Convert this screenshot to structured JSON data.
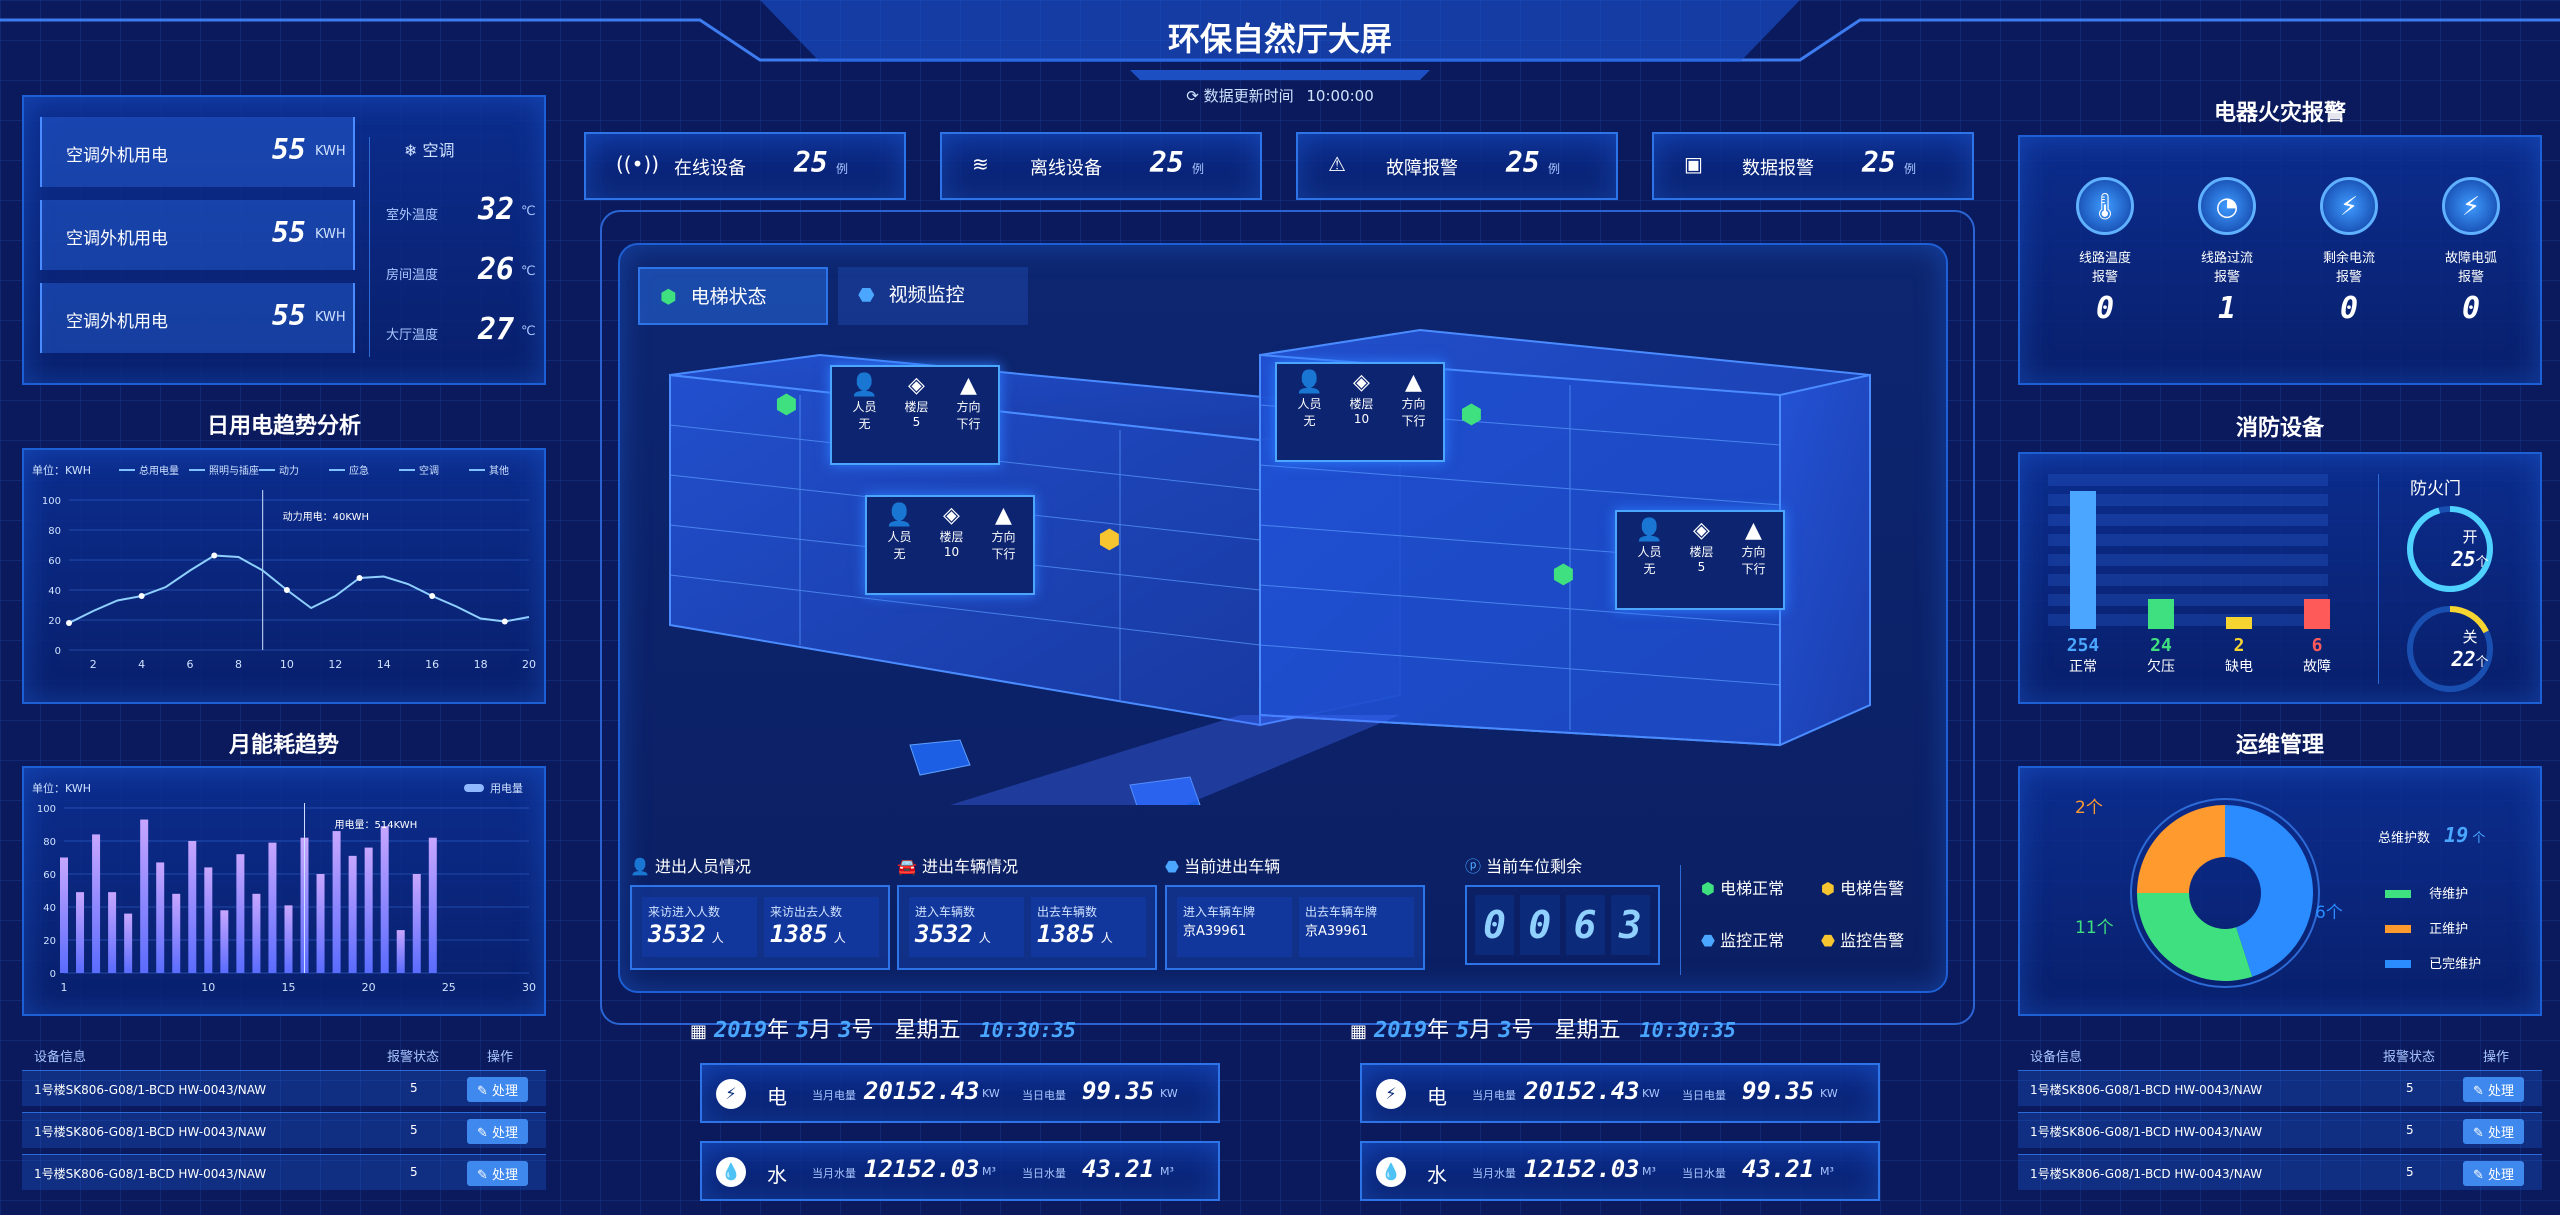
{
  "header": {
    "title": "环保自然厅大屏",
    "update_label": "数据更新时间",
    "update_time": "10:00:00"
  },
  "ac": {
    "rows": [
      {
        "label": "空调外机用电",
        "value": "55",
        "unit": "KWH"
      },
      {
        "label": "空调外机用电",
        "value": "55",
        "unit": "KWH"
      },
      {
        "label": "空调外机用电",
        "value": "55",
        "unit": "KWH"
      }
    ],
    "right_title": "空调",
    "temps": [
      {
        "label": "室外温度",
        "value": "32",
        "unit": "℃"
      },
      {
        "label": "房间温度",
        "value": "26",
        "unit": "℃"
      },
      {
        "label": "大厅温度",
        "value": "27",
        "unit": "℃"
      }
    ]
  },
  "daily": {
    "title": "日用电趋势分析",
    "unit": "单位：KWH",
    "legend": [
      "总用电量",
      "照明与插座",
      "动力",
      "应急",
      "空调",
      "其他"
    ],
    "tooltip": "动力用电：40KWH"
  },
  "monthly": {
    "title": "月能耗趋势",
    "unit": "单位：KWH",
    "legend": "用电量",
    "tooltip": "用电量：514KWH"
  },
  "stats": [
    {
      "label": "在线设备",
      "value": "25",
      "unit": "例"
    },
    {
      "label": "离线设备",
      "value": "25",
      "unit": "例"
    },
    {
      "label": "故障报警",
      "value": "25",
      "unit": "例"
    },
    {
      "label": "数据报警",
      "value": "25",
      "unit": "例"
    }
  ],
  "tabs": [
    "电梯状态",
    "视频监控"
  ],
  "elevators": [
    {
      "person_label": "人员",
      "person": "无",
      "floor_label": "楼层",
      "floor": "5",
      "dir_label": "方向",
      "dir": "下行"
    },
    {
      "person_label": "人员",
      "person": "无",
      "floor_label": "楼层",
      "floor": "10",
      "dir_label": "方向",
      "dir": "下行"
    },
    {
      "person_label": "人员",
      "person": "无",
      "floor_label": "楼层",
      "floor": "10",
      "dir_label": "方向",
      "dir": "下行"
    },
    {
      "person_label": "人员",
      "person": "无",
      "floor_label": "楼层",
      "floor": "5",
      "dir_label": "方向",
      "dir": "下行"
    }
  ],
  "people": {
    "title": "进出人员情况",
    "in_label": "来访进入人数",
    "in": "3532",
    "out_label": "来访出去人数",
    "out": "1385",
    "unit": "人"
  },
  "vehicles": {
    "title": "进出车辆情况",
    "in_label": "进入车辆数",
    "in": "3532",
    "out_label": "出去车辆数",
    "out": "1385",
    "unit": "人"
  },
  "current_vehicle": {
    "title": "当前进出车辆",
    "in_label": "进入车辆车牌",
    "in": "京A39961",
    "out_label": "出去车辆车牌",
    "out": "京A39961"
  },
  "parking": {
    "title": "当前车位剩余",
    "digits": [
      "0",
      "0",
      "6",
      "3"
    ]
  },
  "legend_status": [
    "电梯正常",
    "电梯告警",
    "监控正常",
    "监控告警"
  ],
  "dates": [
    {
      "year": "2019",
      "y": "年",
      "month": "5",
      "m": "月",
      "day": "3",
      "d": "号",
      "week": "星期五",
      "time": "10:30:35"
    },
    {
      "year": "2019",
      "y": "年",
      "month": "5",
      "m": "月",
      "day": "3",
      "d": "号",
      "week": "星期五",
      "time": "10:30:35"
    }
  ],
  "meters": [
    {
      "elec_label": "电",
      "water_label": "水",
      "cur_label": "当月电量",
      "cur": "20152.43",
      "cur_unit": "KW",
      "day_label": "当日电量",
      "day": "99.35",
      "day_unit": "KW",
      "wcur_label": "当月水量",
      "wcur": "12152.03",
      "wunit": "M³",
      "wday_label": "当日水量",
      "wday": "43.21"
    },
    {
      "elec_label": "电",
      "water_label": "水",
      "cur_label": "当月电量",
      "cur": "20152.43",
      "cur_unit": "KW",
      "day_label": "当日电量",
      "day": "99.35",
      "day_unit": "KW",
      "wcur_label": "当月水量",
      "wcur": "12152.03",
      "wunit": "M³",
      "wday_label": "当日水量",
      "wday": "43.21"
    }
  ],
  "table": {
    "headers": [
      "设备信息",
      "报警状态",
      "操作"
    ],
    "rows": [
      {
        "info": "1号楼SK806-G08/1-BCD HW-0043/NAW",
        "status": "5",
        "op": "处理"
      },
      {
        "info": "1号楼SK806-G08/1-BCD HW-0043/NAW",
        "status": "5",
        "op": "处理"
      },
      {
        "info": "1号楼SK806-G08/1-BCD HW-0043/NAW",
        "status": "5",
        "op": "处理"
      }
    ]
  },
  "fire": {
    "title": "电器火灾报警",
    "items": [
      {
        "label1": "线路温度",
        "label2": "报警",
        "value": "0"
      },
      {
        "label1": "线路过流",
        "label2": "报警",
        "value": "1"
      },
      {
        "label1": "剩余电流",
        "label2": "报警",
        "value": "0"
      },
      {
        "label1": "故障电弧",
        "label2": "报警",
        "value": "0"
      }
    ]
  },
  "fireprot": {
    "title": "消防设备",
    "bars": [
      {
        "value": "254",
        "label": "正常",
        "color": "#4aa6ff",
        "h": 0.92
      },
      {
        "value": "24",
        "label": "欠压",
        "color": "#3fe07f",
        "h": 0.2
      },
      {
        "value": "2",
        "label": "缺电",
        "color": "#f6d531",
        "h": 0.08
      },
      {
        "value": "6",
        "label": "故障",
        "color": "#ff5a5a",
        "h": 0.2
      }
    ],
    "door_title": "防火门",
    "open_label": "开",
    "open": "25",
    "close_label": "关",
    "close": "22",
    "count_unit": "个"
  },
  "ops": {
    "title": "运维管理",
    "total_label": "总维护数",
    "total": "19",
    "total_unit": "个",
    "slices": [
      {
        "label": "待维护",
        "value": "11个",
        "color": "#3fe07f",
        "frac": 0.3
      },
      {
        "label": "正维护",
        "value": "2个",
        "color": "#ff9a2e",
        "frac": 0.25
      },
      {
        "label": "已完维护",
        "value": "6个",
        "color": "#2a8cff",
        "frac": 0.45
      }
    ]
  },
  "chart_data": [
    {
      "type": "line",
      "title": "日用电趋势分析",
      "x": [
        1,
        2,
        3,
        4,
        5,
        6,
        7,
        8,
        9,
        10,
        11,
        12,
        13,
        14,
        15,
        16,
        17,
        18,
        19,
        20
      ],
      "y": [
        18,
        26,
        33,
        36,
        42,
        53,
        63,
        62,
        53,
        40,
        28,
        36,
        48,
        49,
        44,
        36,
        29,
        21,
        19,
        22
      ],
      "ylim": [
        0,
        100
      ],
      "xticks": [
        2,
        4,
        6,
        8,
        10,
        12,
        14,
        16,
        18,
        20
      ],
      "yticks": [
        0,
        20,
        40,
        60,
        80,
        100
      ]
    },
    {
      "type": "bar",
      "title": "月能耗趋势",
      "x": [
        1,
        2,
        3,
        4,
        5,
        6,
        7,
        8,
        9,
        10,
        11,
        12,
        13,
        14,
        15,
        16,
        17,
        18,
        19,
        20,
        21,
        22,
        23,
        24,
        25,
        26,
        27,
        28,
        29,
        30
      ],
      "values": [
        70,
        49,
        84,
        49,
        36,
        93,
        67,
        48,
        80,
        64,
        38,
        72,
        48,
        79,
        41,
        82,
        60,
        86,
        71,
        76,
        89,
        26,
        60,
        82,
        0,
        0,
        0,
        0,
        0,
        0
      ],
      "ylim": [
        0,
        100
      ],
      "xticks": [
        1,
        10,
        15,
        20,
        25,
        30
      ],
      "yticks": [
        0,
        20,
        40,
        60,
        80,
        100
      ]
    }
  ]
}
